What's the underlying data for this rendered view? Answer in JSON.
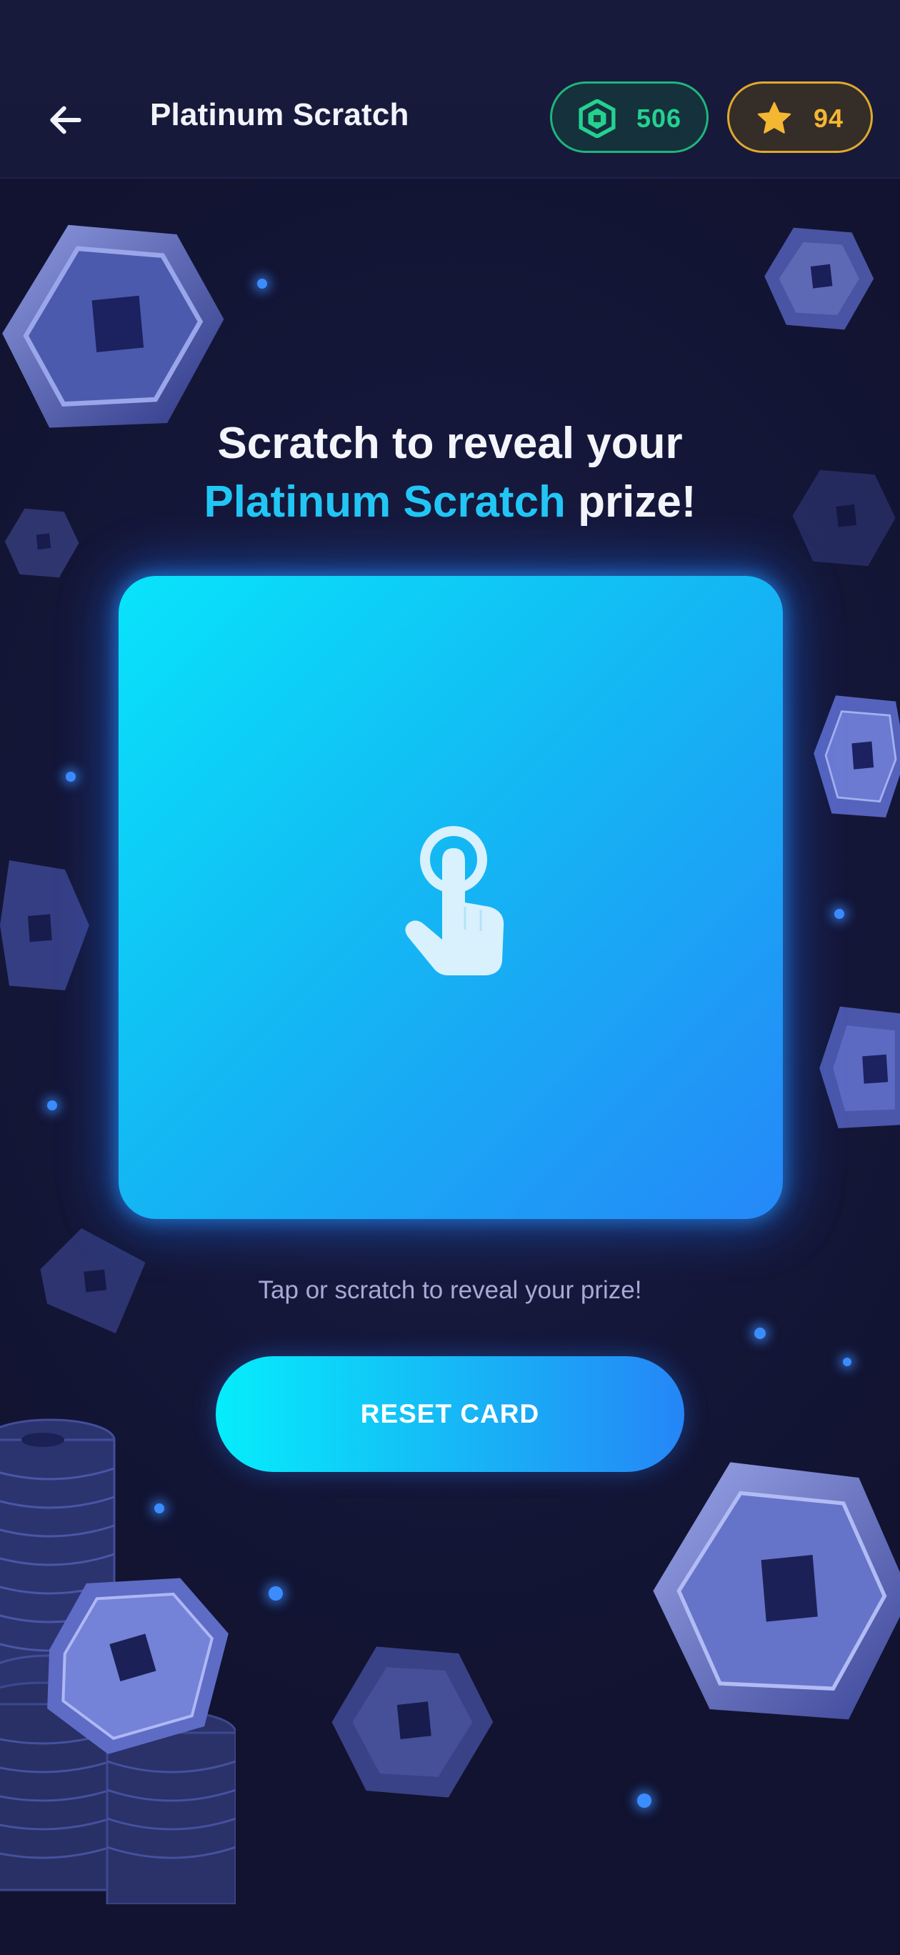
{
  "header": {
    "title": "Platinum Scratch",
    "back_icon": "arrow-left-icon",
    "coins": {
      "value": "506",
      "icon": "hexagon-coin-icon",
      "color": "#24d190"
    },
    "stars": {
      "value": "94",
      "icon": "star-icon",
      "color": "#f3b732"
    }
  },
  "main": {
    "headline_line1": "Scratch to reveal your",
    "headline_accent": "Platinum Scratch",
    "headline_suffix": " prize!",
    "card_icon": "tap-hand-icon",
    "hint": "Tap or scratch to reveal your prize!",
    "reset_label": "RESET CARD"
  },
  "colors": {
    "background": "#141634",
    "accent": "#22c6f5",
    "card_gradient_start": "#08e4fb",
    "card_gradient_end": "#2588f8"
  }
}
